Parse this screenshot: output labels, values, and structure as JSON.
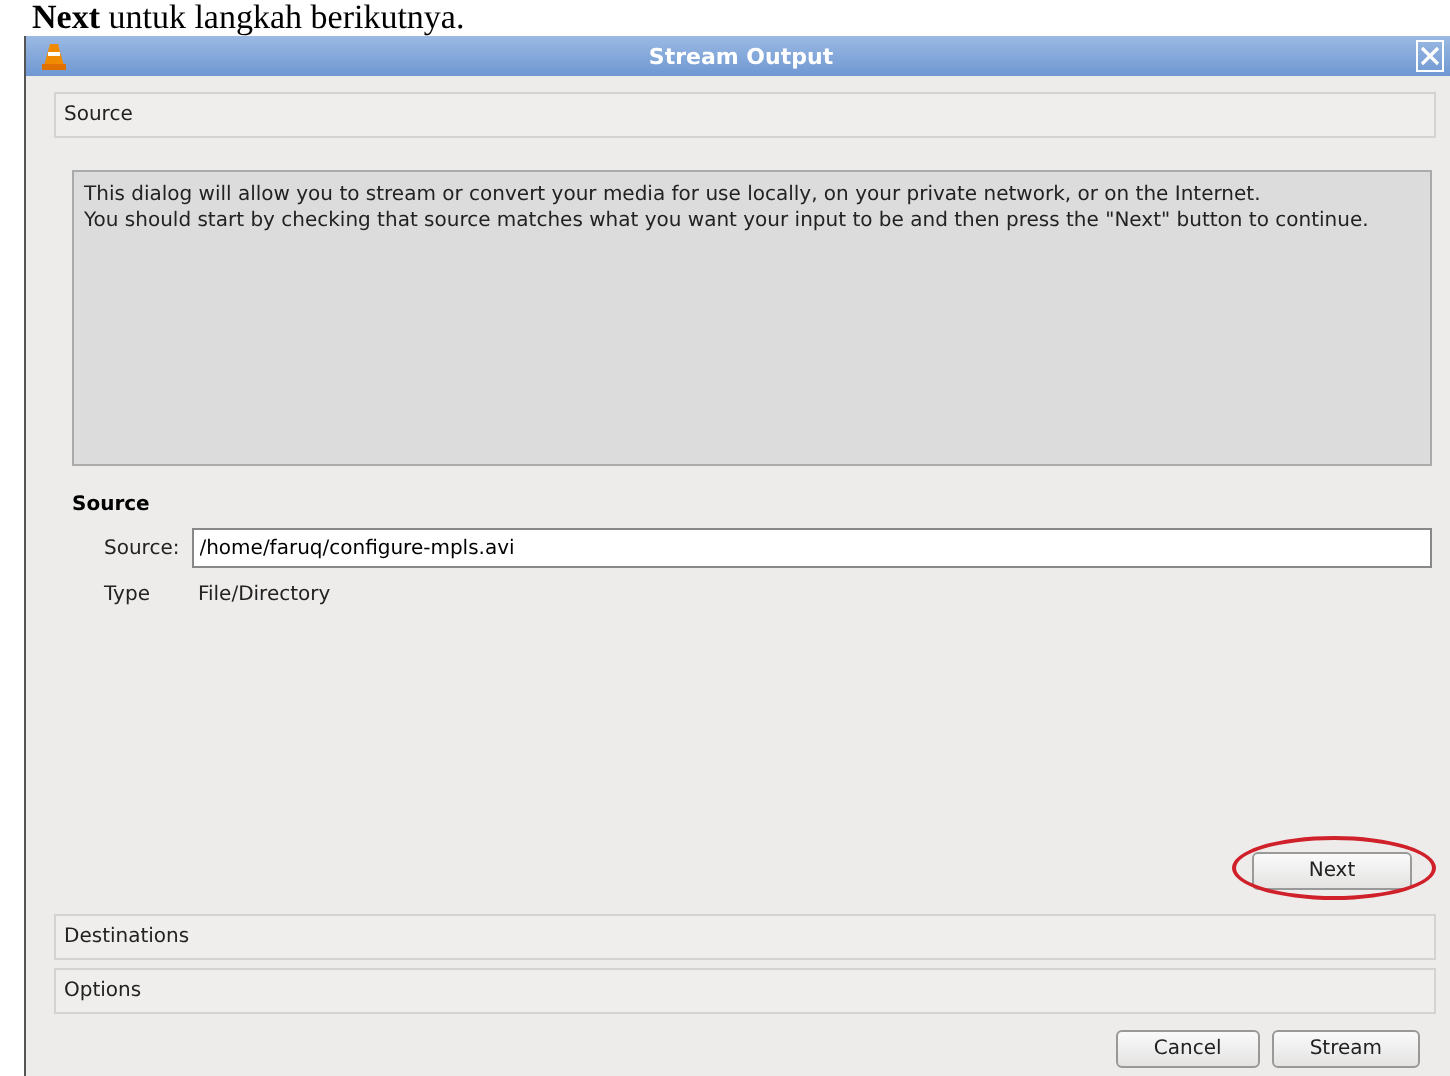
{
  "caption": "**Next** untuk langkah berikutnya.",
  "window": {
    "title": "Stream Output"
  },
  "sections": [
    {
      "label": "Source"
    },
    {
      "label": "Destinations"
    },
    {
      "label": "Options"
    }
  ],
  "description": [
    "This dialog will allow you to stream or convert your media for use locally, on your private network, or on the Internet.",
    "You should start by checking that source matches what you want your input to be and then press the \"Next\" button to continue."
  ],
  "source_group": {
    "title": "Source",
    "field_label": "Source:",
    "value": "/home/faruq/configure-mpls.avi",
    "type_label": "Type",
    "type_value": "File/Directory"
  },
  "next_button": {
    "label": "Next",
    "highlighted": true
  },
  "buttons": [
    "Cancel",
    "Stream"
  ]
}
